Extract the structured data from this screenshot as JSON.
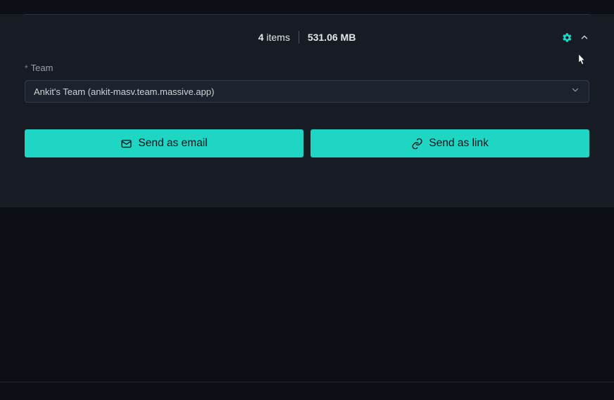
{
  "summary": {
    "item_count_num": "4",
    "item_count_suffix": " items",
    "file_size": "531.06 MB"
  },
  "team": {
    "label": "Team",
    "selected": "Ankit's Team (ankit-masv.team.massive.app)"
  },
  "buttons": {
    "send_email": "Send as email",
    "send_link": "Send as link"
  },
  "colors": {
    "accent": "#1fd6c4"
  }
}
